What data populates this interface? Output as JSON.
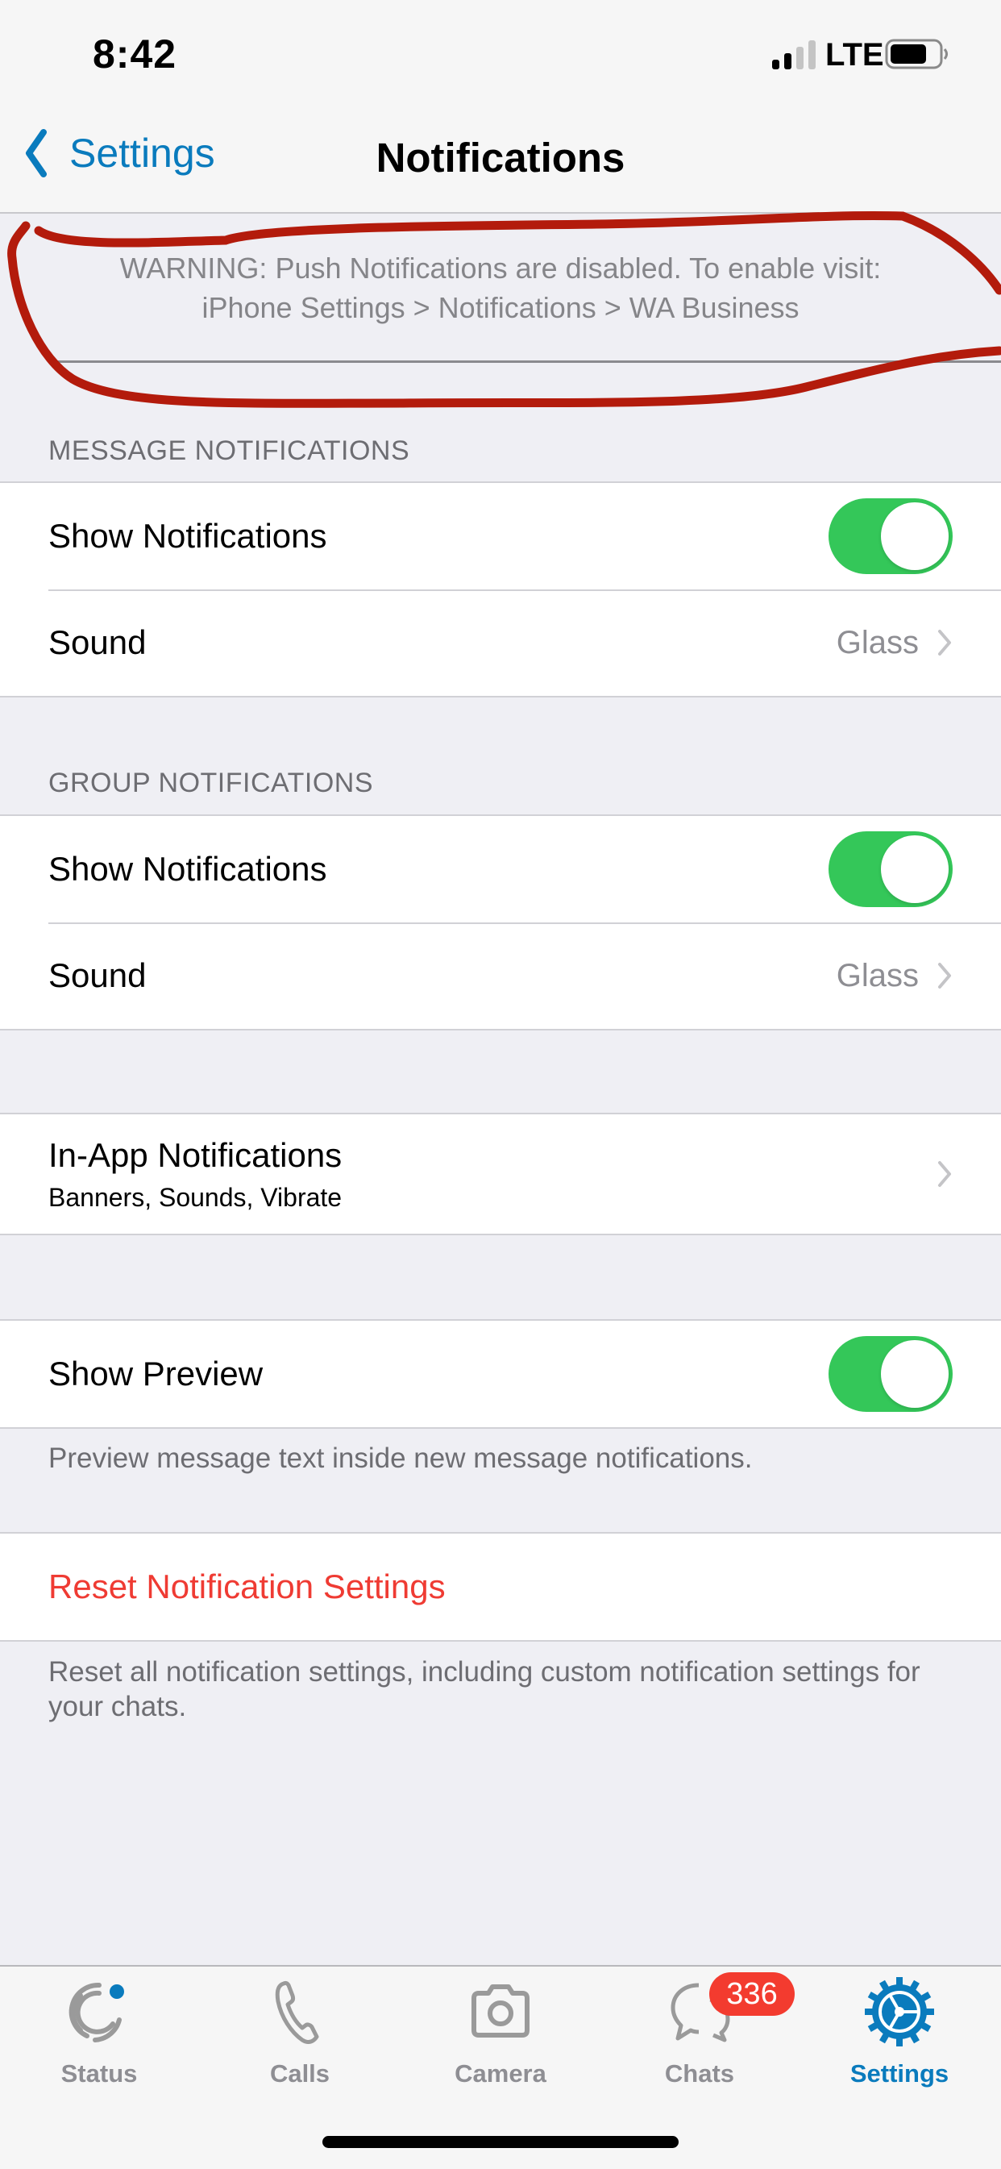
{
  "status_bar": {
    "time": "8:42",
    "network": "LTE",
    "battery_icon": "battery-icon",
    "signal_icon": "signal-icon"
  },
  "nav": {
    "back_label": "Settings",
    "title": "Notifications"
  },
  "warning": {
    "line1": "WARNING: Push Notifications are disabled. To enable visit:",
    "line2": "iPhone Settings > Notifications > WA Business",
    "annotation_color": "#b31b0c"
  },
  "message_notifications": {
    "header": "MESSAGE NOTIFICATIONS",
    "show_label": "Show Notifications",
    "show_on": true,
    "sound_label": "Sound",
    "sound_value": "Glass"
  },
  "group_notifications": {
    "header": "GROUP NOTIFICATIONS",
    "show_label": "Show Notifications",
    "show_on": true,
    "sound_label": "Sound",
    "sound_value": "Glass"
  },
  "in_app": {
    "title": "In-App Notifications",
    "subtitle": "Banners, Sounds, Vibrate"
  },
  "preview": {
    "label": "Show Preview",
    "on": true,
    "footer": "Preview message text inside new message notifications."
  },
  "reset": {
    "label": "Reset Notification Settings",
    "footer": "Reset all notification settings, including custom notification settings for your chats."
  },
  "tabs": [
    {
      "label": "Status",
      "icon": "status-icon",
      "active": false
    },
    {
      "label": "Calls",
      "icon": "phone-icon",
      "active": false
    },
    {
      "label": "Camera",
      "icon": "camera-icon",
      "active": false
    },
    {
      "label": "Chats",
      "icon": "chats-icon",
      "active": false,
      "badge": "336"
    },
    {
      "label": "Settings",
      "icon": "gear-icon",
      "active": true
    }
  ],
  "colors": {
    "accent": "#0a7bbd",
    "toggle_on": "#34c759",
    "danger": "#ef3b33",
    "badge": "#f33b2f"
  }
}
